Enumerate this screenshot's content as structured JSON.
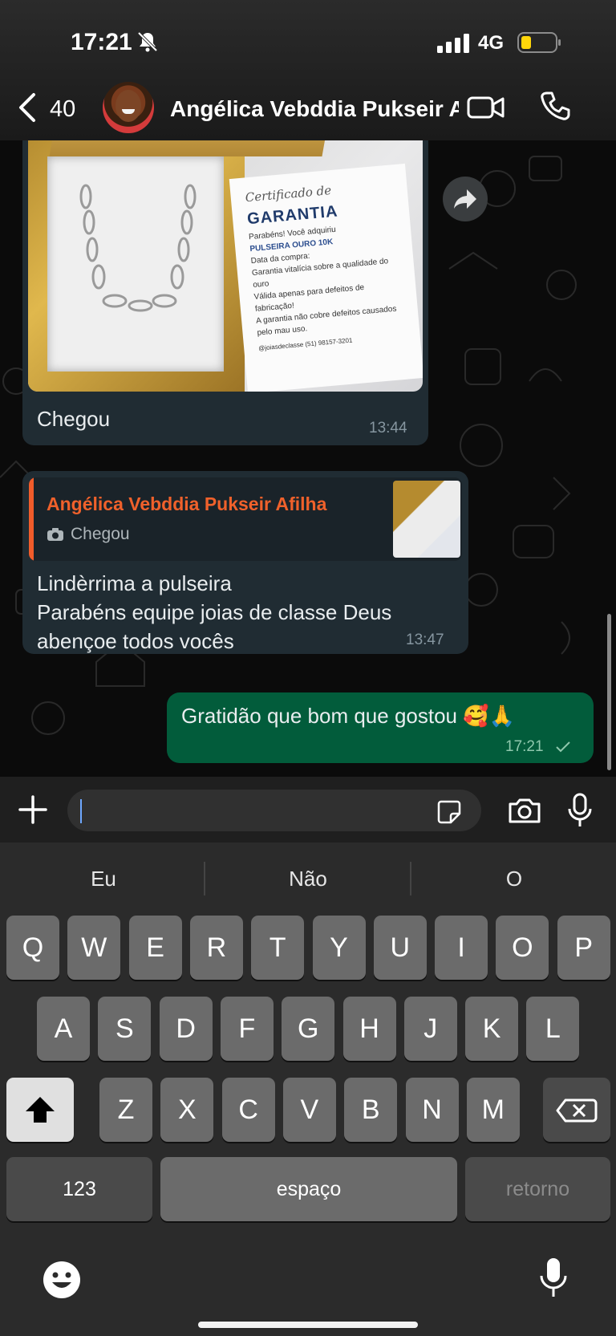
{
  "status": {
    "time": "17:21",
    "network": "4G"
  },
  "header": {
    "back_count": "40",
    "contact_name": "Angélica Vebddia Pukseir Afilha"
  },
  "messages": {
    "image_msg": {
      "caption": "Chegou",
      "time": "13:44",
      "certificate": {
        "heading": "Certificado de",
        "big": "GARANTIA",
        "lines": [
          "Parabéns! Você adquiriu",
          "PULSEIRA OURO 10K",
          "Data da compra:",
          "Garantia vitalícia sobre a qualidade do ouro",
          "Válida apenas para defeitos de fabricação!",
          "A garantia não cobre defeitos causados pelo mau uso.",
          "@joiasdeclasse   (51) 98157-3201"
        ]
      }
    },
    "reply_msg": {
      "quoted_name": "Angélica Vebddia Pukseir Afilha",
      "quoted_text": "Chegou",
      "text": "Lindèrrima a pulseira\nParabéns equipe joias de classe Deus\nabençoe todos vocês",
      "time": "13:47"
    },
    "outgoing_msg": {
      "text": "Gratidão que bom que gostou 🥰🙏",
      "time": "17:21"
    }
  },
  "input": {
    "placeholder": "",
    "value": ""
  },
  "keyboard": {
    "suggestions": [
      "Eu",
      "Não",
      "O"
    ],
    "row1": [
      "Q",
      "W",
      "E",
      "R",
      "T",
      "Y",
      "U",
      "I",
      "O",
      "P"
    ],
    "row2": [
      "A",
      "S",
      "D",
      "F",
      "G",
      "H",
      "J",
      "K",
      "L"
    ],
    "row3": [
      "Z",
      "X",
      "C",
      "V",
      "B",
      "N",
      "M"
    ],
    "numbers_label": "123",
    "space_label": "espaço",
    "return_label": "retorno"
  },
  "icons": {
    "bell": "bell-slash-icon",
    "back": "chevron-left-icon",
    "video": "video-call-icon",
    "call": "phone-icon",
    "forward": "forward-icon",
    "plus": "plus-icon",
    "sticker": "sticker-icon",
    "camera": "camera-icon",
    "mic": "microphone-icon",
    "shift": "shift-icon",
    "backspace": "backspace-icon",
    "emoji": "emoji-icon"
  },
  "colors": {
    "incoming": "#202c33",
    "outgoing": "#025c3b",
    "quote_accent": "#f15c2a"
  }
}
